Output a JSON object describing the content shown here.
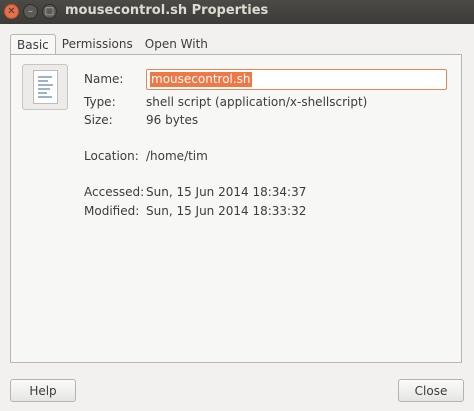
{
  "window": {
    "title": "mousecontrol.sh Properties",
    "controls": {
      "close": "✕",
      "minimize": "–",
      "maximize": "□"
    }
  },
  "tabs": [
    {
      "label": "Basic",
      "active": true
    },
    {
      "label": "Permissions",
      "active": false
    },
    {
      "label": "Open With",
      "active": false
    }
  ],
  "basic": {
    "icon": "text-file-icon",
    "name_label": "Name:",
    "name_value": "mousecontrol.sh",
    "type_label": "Type:",
    "type_value": "shell script (application/x-shellscript)",
    "size_label": "Size:",
    "size_value": "96 bytes",
    "location_label": "Location:",
    "location_value": "/home/tim",
    "accessed_label": "Accessed:",
    "accessed_value": "Sun, 15 Jun 2014 18:34:37",
    "modified_label": "Modified:",
    "modified_value": "Sun, 15 Jun 2014 18:33:32"
  },
  "buttons": {
    "help": "Help",
    "close": "Close"
  },
  "colors": {
    "accent": "#f07746",
    "titlebar": "#3c3b37",
    "close_button": "#e5704a"
  }
}
